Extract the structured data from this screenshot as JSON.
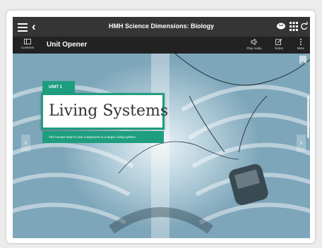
{
  "app": {
    "title": "HMH Science Dimensions: Biology"
  },
  "subbar": {
    "contents_label": "Contents",
    "page_title": "Unit Opener",
    "tools": [
      {
        "label": "Play Audio",
        "icon": "speaker-icon"
      },
      {
        "label": "Notes",
        "icon": "pencil-note-icon"
      },
      {
        "label": "More",
        "icon": "more-vertical-icon"
      }
    ]
  },
  "topbar_icons": [
    "menu-icon",
    "back-icon",
    "brain-icon",
    "grid-icon",
    "refresh-icon"
  ],
  "content": {
    "unit_badge": "UNIT 1",
    "heading": "Living Systems",
    "caption": "The human heart is one component in a larger, living system.",
    "image_icon": "chest-xray-pacemaker-image"
  },
  "colors": {
    "topbar": "#353535",
    "subbar": "#222222",
    "accent": "#1e9e7f"
  }
}
